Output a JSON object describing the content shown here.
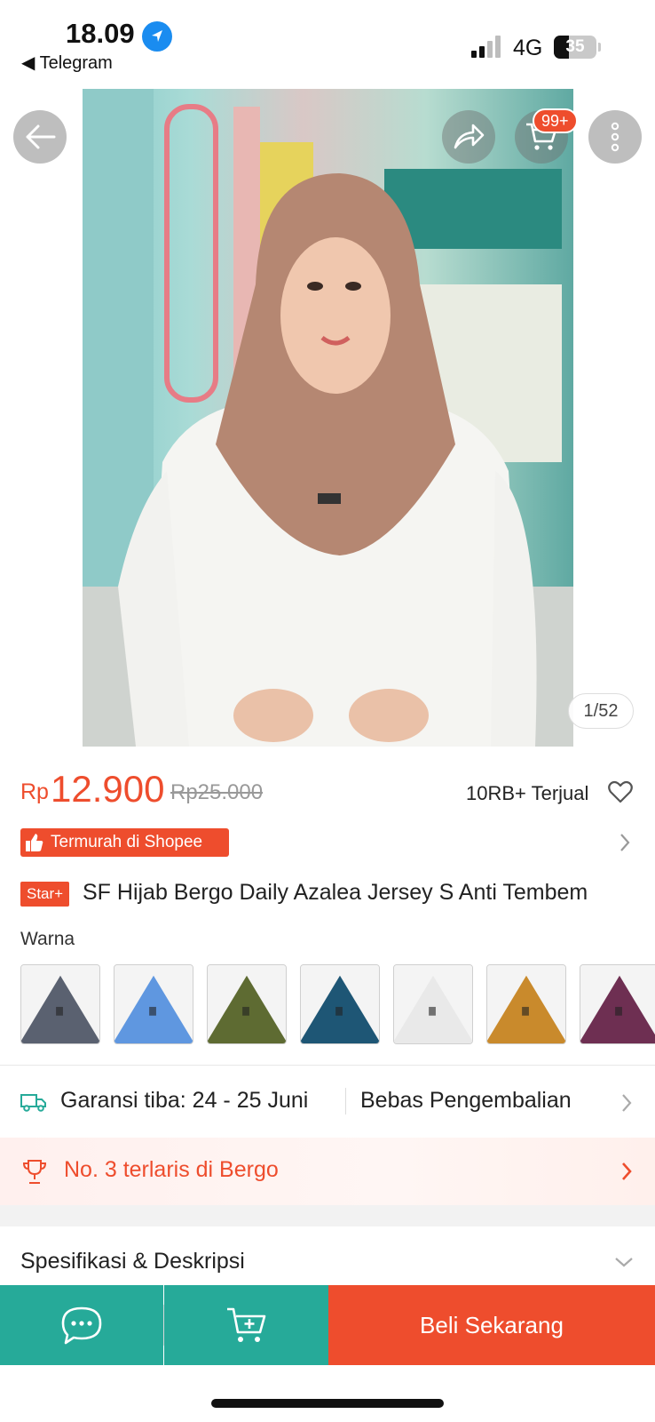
{
  "status_bar": {
    "time": "18.09",
    "back_app": "◀ Telegram",
    "network": "4G",
    "battery": "35"
  },
  "gallery": {
    "cart_badge": "99+",
    "counter": "1/52"
  },
  "price": {
    "currency": "Rp",
    "current": "12.900",
    "original": "Rp25.000",
    "sold": "10RB+ Terjual"
  },
  "promo": {
    "label": "Termurah di Shopee"
  },
  "product": {
    "badge": "Star+",
    "title": "SF Hijab Bergo Daily Azalea Jersey S Anti Tembem"
  },
  "variants": {
    "label": "Warna",
    "colors": [
      "#5a6170",
      "#5f97e0",
      "#5e6b32",
      "#1e5675",
      "#e9e9e9",
      "#c98a2c",
      "#6e2f52"
    ]
  },
  "shipping": {
    "delivery": "Garansi tiba: 24 - 25 Juni",
    "returns": "Bebas Pengembalian"
  },
  "bestseller": {
    "label": "No. 3 terlaris di Bergo"
  },
  "spec": {
    "label": "Spesifikasi & Deskripsi"
  },
  "bottom_bar": {
    "buy_label": "Beli Sekarang"
  },
  "colors": {
    "accent": "#ee4d2d",
    "teal": "#26aa99"
  }
}
